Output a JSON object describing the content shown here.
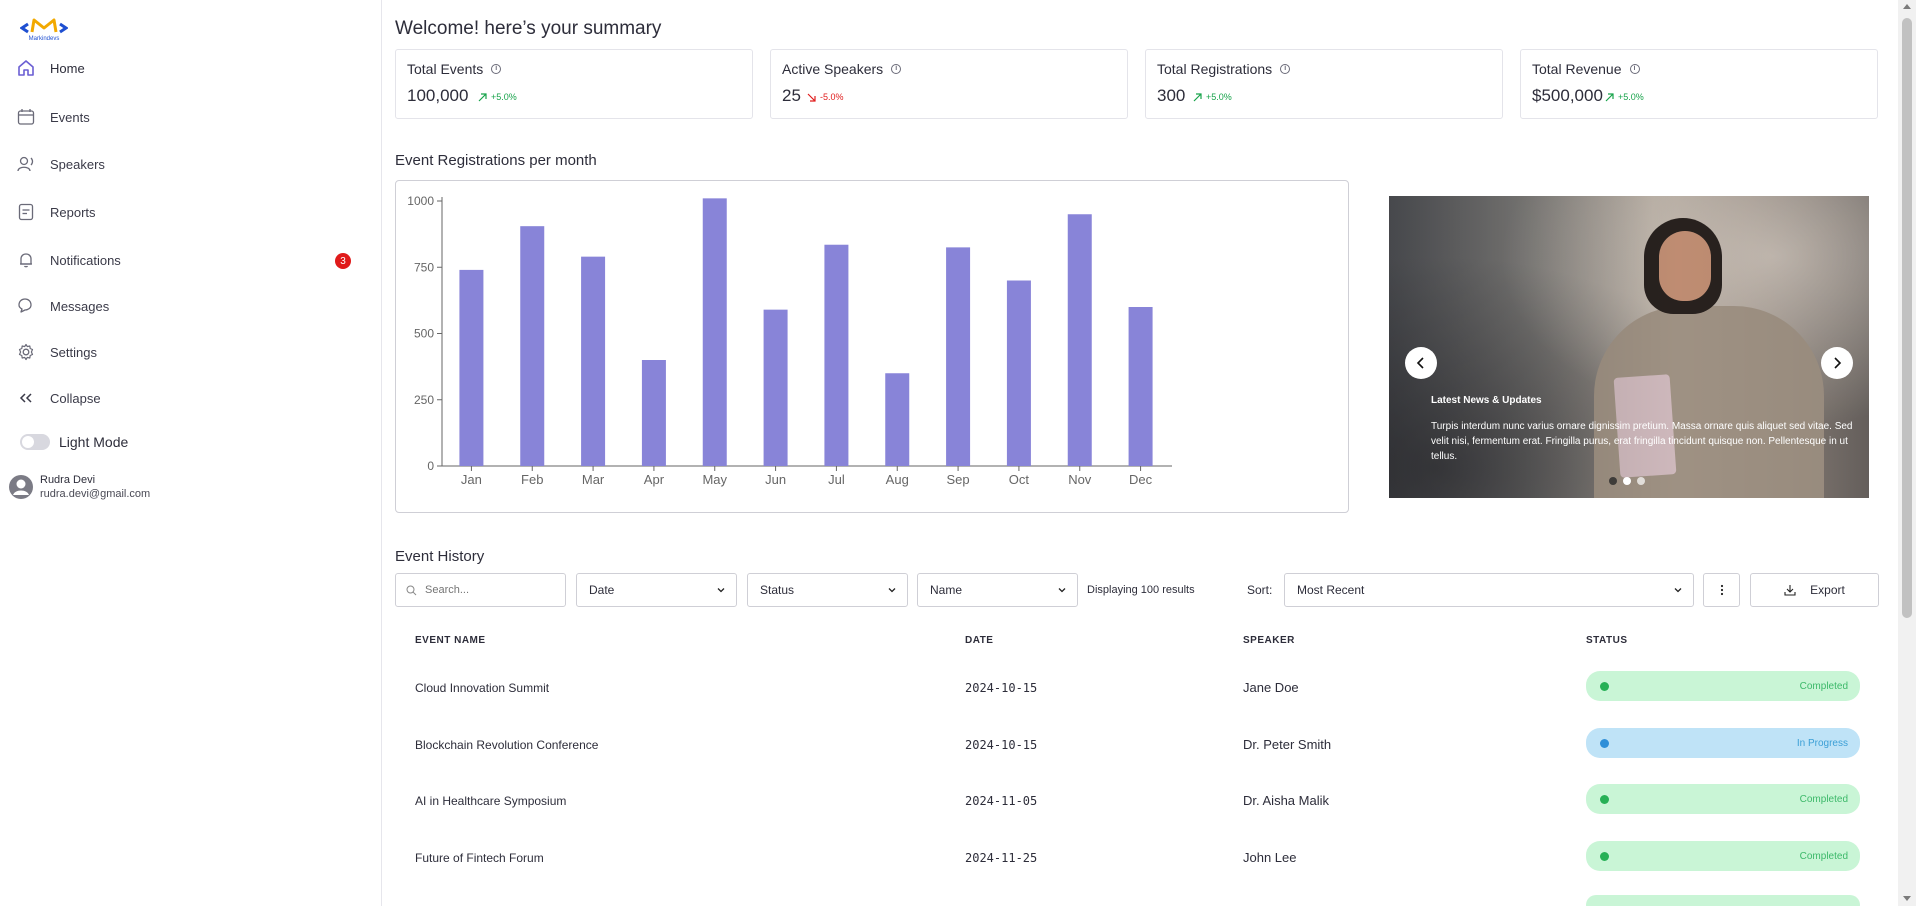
{
  "sidebar": {
    "logo_text": "Markindevs",
    "items": [
      {
        "label": "Home",
        "icon": "home-icon"
      },
      {
        "label": "Events",
        "icon": "calendar-icon"
      },
      {
        "label": "Speakers",
        "icon": "speakers-icon"
      },
      {
        "label": "Reports",
        "icon": "report-icon"
      },
      {
        "label": "Notifications",
        "icon": "bell-icon",
        "badge": "3"
      },
      {
        "label": "Messages",
        "icon": "chat-icon"
      },
      {
        "label": "Settings",
        "icon": "gear-icon"
      },
      {
        "label": "Collapse",
        "icon": "chevrons-left-icon"
      }
    ],
    "mode_label": "Light Mode",
    "user": {
      "name": "Rudra Devi",
      "email": "rudra.devi@gmail.com"
    }
  },
  "header": {
    "title": "Welcome! here’s your summary"
  },
  "stats": [
    {
      "title": "Total Events",
      "value": "100,000",
      "trend": "+5.0%",
      "direction": "up"
    },
    {
      "title": "Active Speakers",
      "value": "25",
      "trend": "-5.0%",
      "direction": "down"
    },
    {
      "title": "Total Registrations",
      "value": "300",
      "trend": "+5.0%",
      "direction": "up"
    },
    {
      "title": "Total Revenue",
      "value": "$500,000",
      "trend": "+5.0%",
      "direction": "up"
    }
  ],
  "chart_section": {
    "title": "Event Registrations per month"
  },
  "chart_data": {
    "type": "bar",
    "title": "",
    "xlabel": "",
    "ylabel": "",
    "categories": [
      "Jan",
      "Feb",
      "Mar",
      "Apr",
      "May",
      "Jun",
      "Jul",
      "Aug",
      "Sep",
      "Oct",
      "Nov",
      "Dec"
    ],
    "values": [
      740,
      905,
      790,
      400,
      1010,
      590,
      835,
      350,
      825,
      700,
      950,
      600
    ],
    "ylim": [
      0,
      1000
    ],
    "yticks": [
      "0",
      "250",
      "500",
      "750",
      "1000"
    ],
    "bar_color": "#8884d8",
    "grid": false
  },
  "carousel": {
    "title": "Latest News & Updates",
    "text": "Turpis interdum nunc varius ornare dignissim pretium. Massa ornare quis aliquet sed vitae. Sed velit nisi, fermentum erat. Fringilla purus, erat fringilla tincidunt quisque non. Pellentesque in ut tellus.",
    "dots": 3,
    "active_dot": 1
  },
  "history": {
    "title": "Event History",
    "search_placeholder": "Search...",
    "filters": {
      "date": "Date",
      "status": "Status",
      "name": "Name"
    },
    "display_count": "Displaying 100 results",
    "sort_label": "Sort:",
    "sort_value": "Most Recent",
    "export_label": "Export",
    "columns": [
      "EVENT NAME",
      "DATE",
      "SPEAKER",
      "STATUS"
    ],
    "rows": [
      {
        "name": "Cloud Innovation Summit",
        "date": "2024-10-15",
        "speaker": "Jane Doe",
        "status": "Completed"
      },
      {
        "name": "Blockchain Revolution Conference",
        "date": "2024-10-15",
        "speaker": "Dr. Peter Smith",
        "status": "In Progress"
      },
      {
        "name": "AI in Healthcare Symposium",
        "date": "2024-11-05",
        "speaker": "Dr. Aisha Malik",
        "status": "Completed"
      },
      {
        "name": "Future of Fintech Forum",
        "date": "2024-11-25",
        "speaker": "John Lee",
        "status": "Completed"
      }
    ]
  },
  "colors": {
    "accent": "#8884d8",
    "up": "#17a34a",
    "down": "#e01b1b",
    "badge": "#e01b1b"
  }
}
